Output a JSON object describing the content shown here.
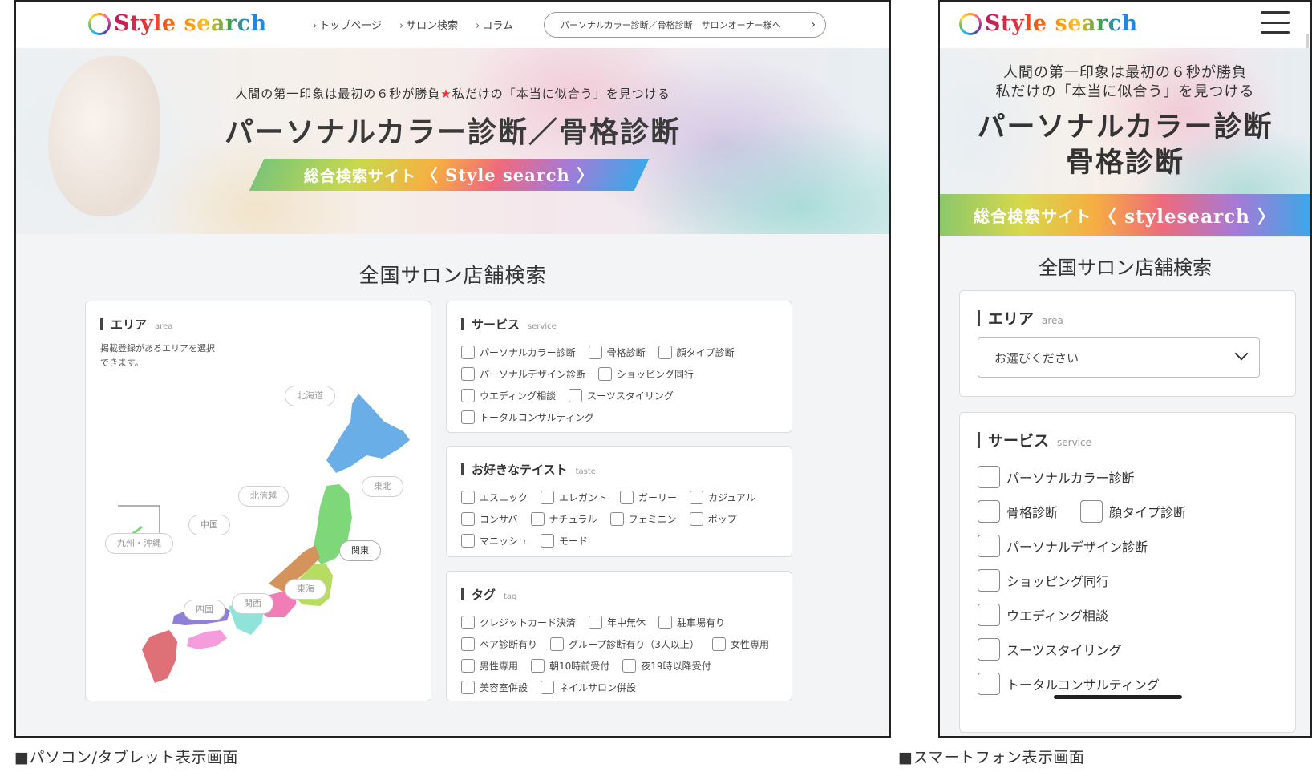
{
  "logo": {
    "text": "Style search"
  },
  "desktop": {
    "nav": [
      "トップページ",
      "サロン検索",
      "コラム"
    ],
    "owner_link": "パーソナルカラー診断／骨格診断　サロンオーナー様へ",
    "hero": {
      "sub_before": "人間の第一印象は最初の６秒が勝負",
      "sub_star": "★",
      "sub_after": "私だけの「本当に似合う」を見つける",
      "title": "パーソナルカラー診断／骨格診断",
      "band_jp": "総合検索サイト",
      "band_en": "〈 Style search 〉"
    },
    "section_title": "全国サロン店舗検索",
    "area": {
      "label": "エリア",
      "label_en": "area",
      "note": "掲載登録があるエリアを選択できます。",
      "regions": [
        "北海道",
        "東北",
        "北信越",
        "関東",
        "中国",
        "九州・沖縄",
        "東海",
        "四国",
        "関西"
      ],
      "active_region": "関東"
    },
    "service": {
      "label": "サービス",
      "label_en": "service",
      "rows": [
        [
          "パーソナルカラー診断",
          "骨格診断",
          "顔タイプ診断"
        ],
        [
          "パーソナルデザイン診断",
          "ショッピング同行"
        ],
        [
          "ウエディング相談",
          "スーツスタイリング"
        ],
        [
          "トータルコンサルティング"
        ]
      ]
    },
    "taste": {
      "label": "お好きなテイスト",
      "label_en": "taste",
      "rows": [
        [
          "エスニック",
          "エレガント",
          "ガーリー",
          "カジュアル"
        ],
        [
          "コンサバ",
          "ナチュラル",
          "フェミニン",
          "ポップ"
        ],
        [
          "マニッシュ",
          "モード"
        ]
      ]
    },
    "tag": {
      "label": "タグ",
      "label_en": "tag",
      "rows": [
        [
          "クレジットカード決済",
          "年中無休",
          "駐車場有り"
        ],
        [
          "ペア診断有り",
          "グループ診断有り（3人以上）",
          "女性専用"
        ],
        [
          "男性専用",
          "朝10時前受付",
          "夜19時以降受付"
        ],
        [
          "美容室併設",
          "ネイルサロン併設"
        ]
      ]
    }
  },
  "mobile": {
    "hero": {
      "sub1": "人間の第一印象は最初の６秒が勝負",
      "sub2": "私だけの「本当に似合う」を見つける",
      "title1": "パーソナルカラー診断",
      "title2": "骨格診断",
      "band_jp": "総合検索サイト",
      "band_en": "〈 stylesearch 〉"
    },
    "section_title": "全国サロン店舗検索",
    "area": {
      "label": "エリア",
      "label_en": "area",
      "select_value": "お選びください"
    },
    "service": {
      "label": "サービス",
      "label_en": "service",
      "rows": [
        [
          "パーソナルカラー診断"
        ],
        [
          "骨格診断",
          "顔タイプ診断"
        ],
        [
          "パーソナルデザイン診断"
        ],
        [
          "ショッピング同行"
        ],
        [
          "ウエディング相談"
        ],
        [
          "スーツスタイリング"
        ],
        [
          "トータルコンサルティング"
        ]
      ]
    }
  },
  "captions": {
    "desktop": "■パソコン/タブレット表示画面",
    "mobile": "■スマートフォン表示画面"
  },
  "colors": {
    "hokkaido": "#6aaee8",
    "tohoku": "#7ed87a",
    "kanto": "#b7dc62",
    "chubu": "#d4935a",
    "tokai": "#f07db5",
    "kinki": "#8fe3d9",
    "chugoku": "#8f7fd8",
    "shikoku": "#f59ddc",
    "kyushu": "#e07078"
  }
}
